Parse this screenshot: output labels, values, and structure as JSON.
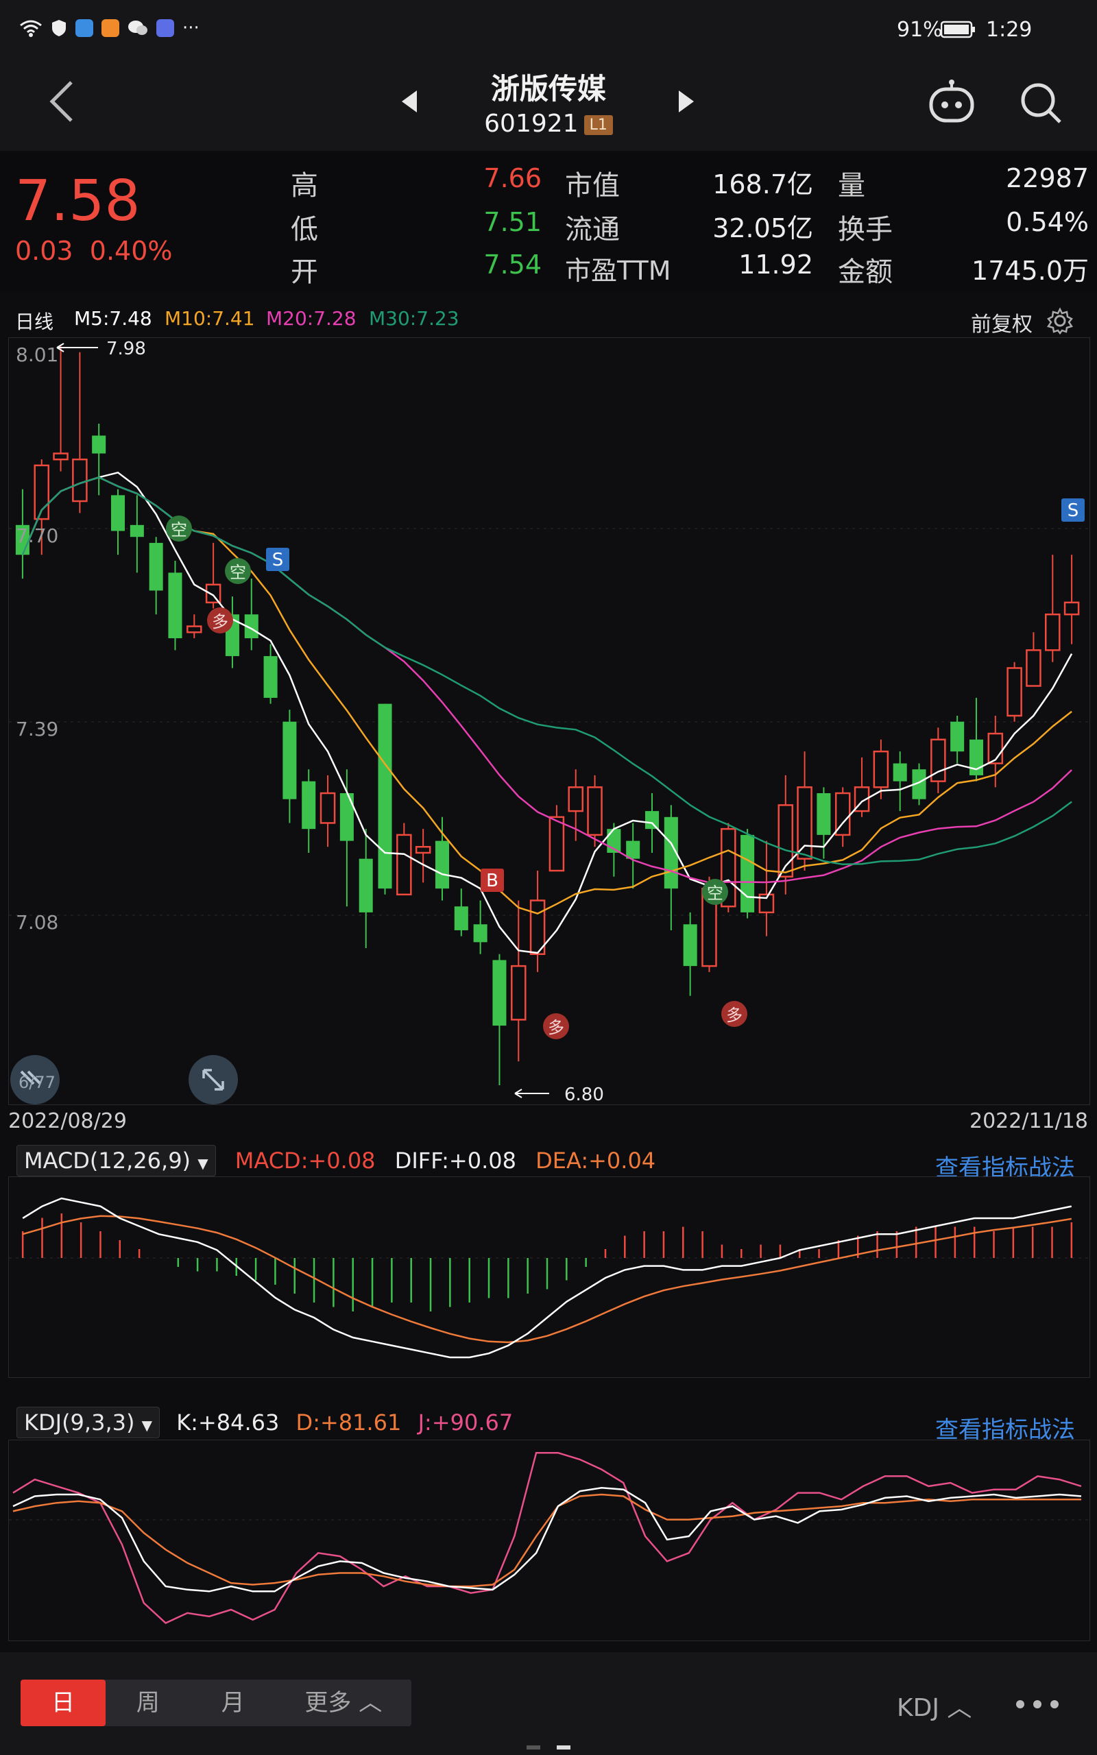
{
  "status": {
    "battery": "91%",
    "time": "1:29"
  },
  "header": {
    "title": "浙版传媒",
    "code": "601921",
    "badge": "L1"
  },
  "quote": {
    "price": "7.58",
    "change": "0.03",
    "change_pct": "0.40%",
    "rows": [
      {
        "l1": "高",
        "v1": "7.66",
        "l2": "市值",
        "v2": "168.7亿",
        "l3": "量",
        "v3": "22987"
      },
      {
        "l1": "低",
        "v1": "7.51",
        "l2": "流通",
        "v2": "32.05亿",
        "l3": "换手",
        "v3": "0.54%"
      },
      {
        "l1": "开",
        "v1": "7.54",
        "l2": "市盈TTM",
        "v2": "11.92",
        "l3": "金额",
        "v3": "1745.0万"
      }
    ]
  },
  "legend": {
    "period": "日线",
    "m5": "M5:7.48",
    "m10": "M10:7.41",
    "m20": "M20:7.28",
    "m30": "M30:7.23",
    "adjust": "前复权"
  },
  "date_start": "2022/08/29",
  "date_end": "2022/11/18",
  "max_label": "7.98",
  "min_label": "6.80",
  "ribbon": "6/77",
  "markers": {
    "b": "B",
    "s": "S",
    "long": "多",
    "short": "空"
  },
  "macd": {
    "name": "MACD(12,26,9)",
    "macd": "MACD:+0.08",
    "diff": "DIFF:+0.08",
    "dea": "DEA:+0.04",
    "link": "查看指标战法"
  },
  "kdj": {
    "name": "KDJ(9,3,3)",
    "k": "K:+84.63",
    "d": "D:+81.61",
    "j": "J:+90.67",
    "link": "查看指标战法"
  },
  "tabs": {
    "day": "日",
    "week": "周",
    "month": "月",
    "more": "更多",
    "indicator": "KDJ"
  },
  "colors": {
    "up": "#ef4a3d",
    "down": "#3ec24e",
    "m5": "#ffffff",
    "m10": "#f5a623",
    "m20": "#e83fb3",
    "m30": "#1f9c72"
  },
  "chart_data": [
    {
      "type": "candlestick",
      "yticks": [
        "8.01",
        "7.70",
        "7.39",
        "7.08"
      ],
      "ylim": [
        6.77,
        8.01
      ],
      "x_range": [
        "2022/08/29",
        "2022/11/18"
      ],
      "series": [
        {
          "name": "M5",
          "label": "M5:7.48"
        },
        {
          "name": "M10",
          "label": "M10:7.41"
        },
        {
          "name": "M20",
          "label": "M20:7.28"
        },
        {
          "name": "M30",
          "label": "M30:7.23"
        }
      ],
      "candles": [
        [
          7.71,
          7.66,
          7.77,
          7.62
        ],
        [
          7.72,
          7.81,
          7.82,
          7.66
        ],
        [
          7.82,
          7.83,
          8.01,
          7.8
        ],
        [
          7.75,
          7.82,
          8.0,
          7.73
        ],
        [
          7.86,
          7.83,
          7.88,
          7.76
        ],
        [
          7.76,
          7.7,
          7.77,
          7.66
        ],
        [
          7.71,
          7.69,
          7.76,
          7.63
        ],
        [
          7.68,
          7.6,
          7.69,
          7.56
        ],
        [
          7.63,
          7.52,
          7.65,
          7.5
        ],
        [
          7.53,
          7.54,
          7.56,
          7.52
        ],
        [
          7.58,
          7.61,
          7.68,
          7.57
        ],
        [
          7.56,
          7.49,
          7.59,
          7.47
        ],
        [
          7.56,
          7.52,
          7.62,
          7.5
        ],
        [
          7.49,
          7.42,
          7.51,
          7.41
        ],
        [
          7.38,
          7.25,
          7.4,
          7.21
        ],
        [
          7.28,
          7.2,
          7.3,
          7.16
        ],
        [
          7.21,
          7.26,
          7.29,
          7.17
        ],
        [
          7.26,
          7.18,
          7.3,
          7.07
        ],
        [
          7.15,
          7.06,
          7.2,
          7.0
        ],
        [
          7.41,
          7.1,
          7.41,
          7.09
        ],
        [
          7.09,
          7.19,
          7.21,
          7.1
        ],
        [
          7.16,
          7.17,
          7.2,
          7.11
        ],
        [
          7.18,
          7.1,
          7.22,
          7.08
        ],
        [
          7.07,
          7.03,
          7.1,
          7.02
        ],
        [
          7.04,
          7.01,
          7.08,
          6.99
        ],
        [
          6.98,
          6.87,
          6.99,
          6.77
        ],
        [
          6.88,
          6.97,
          7.08,
          6.81
        ],
        [
          6.99,
          7.08,
          7.13,
          6.96
        ],
        [
          7.13,
          7.22,
          7.24,
          7.13
        ],
        [
          7.23,
          7.27,
          7.3,
          7.18
        ],
        [
          7.19,
          7.27,
          7.29,
          7.17
        ],
        [
          7.2,
          7.16,
          7.21,
          7.12
        ],
        [
          7.18,
          7.15,
          7.21,
          7.1
        ],
        [
          7.23,
          7.2,
          7.26,
          7.16
        ],
        [
          7.22,
          7.1,
          7.24,
          7.03
        ],
        [
          7.04,
          6.97,
          7.06,
          6.92
        ],
        [
          6.97,
          7.1,
          7.12,
          6.96
        ],
        [
          7.07,
          7.2,
          7.21,
          7.06
        ],
        [
          7.19,
          7.06,
          7.2,
          7.05
        ],
        [
          7.06,
          7.09,
          7.18,
          7.02
        ],
        [
          7.12,
          7.24,
          7.29,
          7.09
        ],
        [
          7.15,
          7.27,
          7.33,
          7.13
        ],
        [
          7.26,
          7.19,
          7.27,
          7.15
        ],
        [
          7.19,
          7.26,
          7.27,
          7.17
        ],
        [
          7.23,
          7.27,
          7.32,
          7.22
        ],
        [
          7.27,
          7.33,
          7.35,
          7.25
        ],
        [
          7.31,
          7.28,
          7.33,
          7.23
        ],
        [
          7.3,
          7.25,
          7.31,
          7.24
        ],
        [
          7.28,
          7.35,
          7.37,
          7.26
        ],
        [
          7.38,
          7.33,
          7.39,
          7.31
        ],
        [
          7.35,
          7.29,
          7.42,
          7.28
        ],
        [
          7.31,
          7.36,
          7.39,
          7.27
        ],
        [
          7.39,
          7.47,
          7.48,
          7.38
        ],
        [
          7.44,
          7.5,
          7.53,
          7.45
        ],
        [
          7.5,
          7.56,
          7.66,
          7.48
        ],
        [
          7.56,
          7.58,
          7.66,
          7.51
        ]
      ]
    },
    {
      "type": "bar",
      "title": "MACD(12,26,9)",
      "series": [
        {
          "name": "DIFF",
          "label": "DIFF:+0.08"
        },
        {
          "name": "DEA",
          "label": "DEA:+0.04"
        },
        {
          "name": "MACD",
          "label": "MACD:+0.08"
        }
      ],
      "hist": [
        0.06,
        0.09,
        0.1,
        0.08,
        0.06,
        0.04,
        0.02,
        0.0,
        -0.02,
        -0.03,
        -0.03,
        -0.04,
        -0.05,
        -0.06,
        -0.08,
        -0.1,
        -0.11,
        -0.12,
        -0.11,
        -0.1,
        -0.1,
        -0.12,
        -0.11,
        -0.1,
        -0.09,
        -0.09,
        -0.08,
        -0.07,
        -0.05,
        -0.02,
        0.02,
        0.05,
        0.06,
        0.06,
        0.07,
        0.06,
        0.03,
        0.02,
        0.03,
        0.03,
        0.02,
        0.02,
        0.04,
        0.05,
        0.06,
        0.06,
        0.07,
        0.07,
        0.07,
        0.07,
        0.06,
        0.07,
        0.07,
        0.07,
        0.08
      ],
      "diff": [
        0.1,
        0.13,
        0.15,
        0.14,
        0.13,
        0.1,
        0.08,
        0.06,
        0.05,
        0.04,
        0.02,
        -0.02,
        -0.06,
        -0.1,
        -0.13,
        -0.15,
        -0.18,
        -0.2,
        -0.21,
        -0.22,
        -0.23,
        -0.24,
        -0.25,
        -0.25,
        -0.24,
        -0.22,
        -0.19,
        -0.15,
        -0.11,
        -0.08,
        -0.05,
        -0.03,
        -0.02,
        -0.02,
        -0.03,
        -0.03,
        -0.02,
        -0.02,
        -0.01,
        0.0,
        0.02,
        0.03,
        0.04,
        0.05,
        0.06,
        0.06,
        0.07,
        0.08,
        0.09,
        0.1,
        0.1,
        0.1,
        0.11,
        0.12,
        0.13
      ]
    },
    {
      "type": "line",
      "title": "KDJ(9,3,3)",
      "series": [
        {
          "name": "K",
          "label": "K:+84.63"
        },
        {
          "name": "D",
          "label": "D:+81.61"
        },
        {
          "name": "J",
          "label": "J:+90.67"
        }
      ],
      "k": [
        78,
        84,
        85,
        85,
        82,
        71,
        45,
        30,
        28,
        27,
        30,
        27,
        27,
        35,
        42,
        45,
        44,
        38,
        35,
        33,
        30,
        29,
        28,
        37,
        50,
        78,
        87,
        89,
        88,
        80,
        58,
        60,
        75,
        78,
        70,
        72,
        68,
        75,
        76,
        79,
        83,
        84,
        81,
        83,
        84,
        85,
        83,
        84,
        85,
        84
      ],
      "d": [
        75,
        78,
        80,
        81,
        80,
        75,
        62,
        52,
        44,
        38,
        32,
        31,
        32,
        34,
        37,
        38,
        38,
        36,
        33,
        31,
        30,
        30,
        31,
        40,
        60,
        78,
        84,
        85,
        84,
        76,
        70,
        70,
        71,
        72,
        74,
        75,
        76,
        77,
        78,
        80,
        80,
        81,
        82,
        81,
        82,
        82,
        82,
        82,
        82,
        82
      ],
      "j": [
        86,
        94,
        90,
        86,
        80,
        55,
        20,
        8,
        14,
        12,
        16,
        10,
        16,
        38,
        50,
        48,
        40,
        30,
        36,
        30,
        30,
        26,
        28,
        60,
        110,
        110,
        106,
        100,
        92,
        60,
        45,
        50,
        70,
        80,
        70,
        76,
        86,
        86,
        82,
        90,
        96,
        96,
        90,
        92,
        86,
        88,
        88,
        96,
        94,
        90
      ]
    }
  ]
}
